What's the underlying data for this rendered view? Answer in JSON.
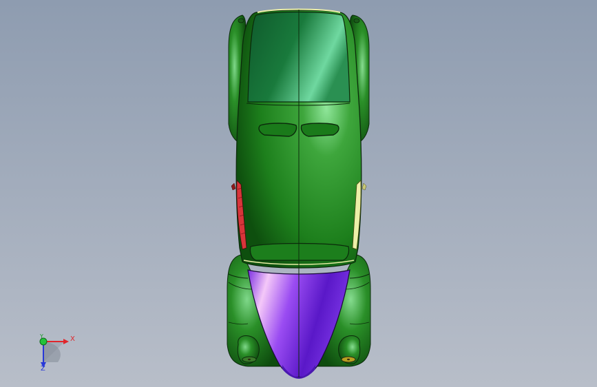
{
  "viewport": {
    "background_top": "#8e9cb0",
    "background_bottom": "#b7bdc8"
  },
  "model": {
    "body_color": "#1f8a20",
    "hood_color": "#8a3cf0",
    "left_glass_color": "#d8353a",
    "right_glass_color": "#ecf0a8",
    "edge_color": "#0b2a0b"
  },
  "triad": {
    "x_label": "X",
    "y_label": "Y",
    "z_label": "Z",
    "x_color": "#e0262c",
    "y_color": "#22c33a",
    "z_color": "#2838d8"
  }
}
